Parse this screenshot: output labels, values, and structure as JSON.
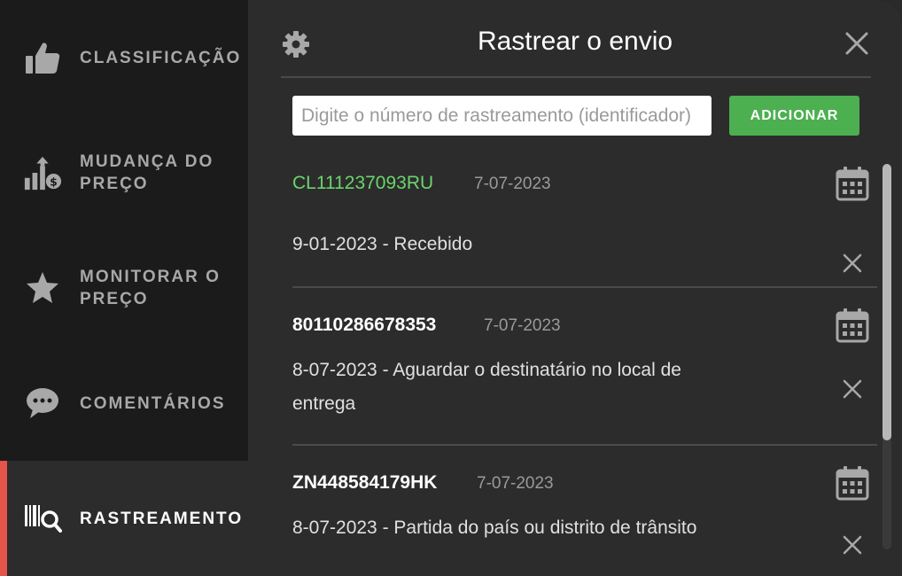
{
  "sidebar": {
    "items": [
      {
        "label": "CLASSIFICAÇÃO",
        "icon": "thumbs-up-icon",
        "active": false
      },
      {
        "label": "MUDANÇA DO PREÇO",
        "icon": "price-chart-icon",
        "active": false
      },
      {
        "label": "MONITORAR O PREÇO",
        "icon": "star-icon",
        "active": false
      },
      {
        "label": "COMENTÁRIOS",
        "icon": "comment-icon",
        "active": false
      },
      {
        "label": "RASTREAMENTO",
        "icon": "barcode-search-icon",
        "active": true
      }
    ]
  },
  "header": {
    "title": "Rastrear o envio",
    "settings_icon": "gear-icon",
    "close_icon": "close-icon"
  },
  "form": {
    "placeholder": "Digite o número de rastreamento (identificador)",
    "add_label": "ADICIONAR"
  },
  "shipments": [
    {
      "number": "CL111237093RU",
      "date": "7-07-2023",
      "status": "9-01-2023 - Recebido",
      "highlight": true
    },
    {
      "number": "80110286678353",
      "date": "7-07-2023",
      "status": "8-07-2023 - Aguardar o destinatário no local de entrega",
      "highlight": false
    },
    {
      "number": "ZN448584179HK",
      "date": "7-07-2023",
      "status": "8-07-2023 - Partida do país ou distrito de trânsito",
      "highlight": false
    }
  ],
  "colors": {
    "accent_active": "#e5534b",
    "add_button": "#4caf50",
    "highlight_number": "#6ad46b"
  }
}
